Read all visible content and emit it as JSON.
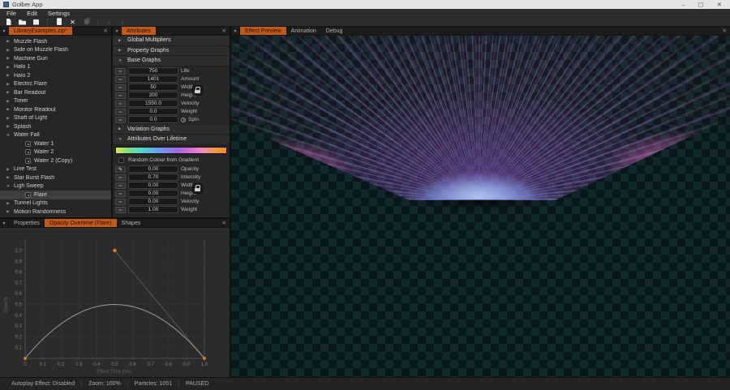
{
  "window": {
    "title": "Golber App",
    "minimize": "–",
    "maximize": "▢",
    "close": "✕"
  },
  "menu": {
    "items": [
      "File",
      "Edit",
      "Settings"
    ]
  },
  "toolbar": {
    "buttons": [
      {
        "name": "new-file-icon",
        "enabled": true
      },
      {
        "name": "open-file-icon",
        "enabled": true
      },
      {
        "name": "save-file-icon",
        "enabled": true
      },
      {
        "name": "separator"
      },
      {
        "name": "paste-icon",
        "enabled": true
      },
      {
        "name": "delete-icon",
        "enabled": true
      },
      {
        "name": "copy-icon",
        "enabled": false
      },
      {
        "name": "separator"
      },
      {
        "name": "move-up-icon",
        "enabled": false
      },
      {
        "name": "move-down-icon",
        "enabled": false
      }
    ]
  },
  "icons": {
    "close": "✕",
    "collapsed": "▶",
    "expanded": "▼",
    "dots": "•••",
    "pencil": "✎"
  },
  "library_panel": {
    "tab": "LibraryExamples.zip*",
    "items": [
      {
        "label": "Muzzle Flash",
        "arrow": "collapsed"
      },
      {
        "label": "Side on Muzzle Flash",
        "arrow": "collapsed"
      },
      {
        "label": "Machine Gun",
        "arrow": "collapsed"
      },
      {
        "label": "Halo 1",
        "arrow": "collapsed"
      },
      {
        "label": "Halo 2",
        "arrow": "collapsed"
      },
      {
        "label": "Electric Flare",
        "arrow": "collapsed"
      },
      {
        "label": "Bar Readout",
        "arrow": "collapsed"
      },
      {
        "label": "Timer",
        "arrow": "collapsed"
      },
      {
        "label": "Monitor Readout",
        "arrow": "collapsed"
      },
      {
        "label": "Shaft of Light",
        "arrow": "collapsed"
      },
      {
        "label": "Splash",
        "arrow": "collapsed"
      },
      {
        "label": "Water Fall",
        "arrow": "expanded"
      },
      {
        "label": "Water 1",
        "depth": 1,
        "icon": "effect-thumbnail-icon"
      },
      {
        "label": "Water 2",
        "depth": 1,
        "icon": "effect-thumbnail-icon"
      },
      {
        "label": "Water 2 (Copy)",
        "depth": 1,
        "icon": "effect-thumbnail-icon"
      },
      {
        "label": "Line Test",
        "arrow": "collapsed"
      },
      {
        "label": "Star Burst Flash",
        "arrow": "collapsed"
      },
      {
        "label": "Ligh Sweep",
        "arrow": "expanded"
      },
      {
        "label": "Flare",
        "depth": 1,
        "icon": "effect-thumbnail-icon",
        "selected": true
      },
      {
        "label": "Tunnel Lights",
        "arrow": "collapsed"
      },
      {
        "label": "Motion Randomness",
        "arrow": "collapsed"
      }
    ]
  },
  "attributes_panel": {
    "tab": "Attributes",
    "sections": [
      {
        "type": "header",
        "label": "Global Multipliers",
        "state": "collapsed"
      },
      {
        "type": "header",
        "label": "Property Graphs",
        "state": "collapsed"
      },
      {
        "type": "header",
        "label": "Base Graphs",
        "state": "expanded"
      },
      {
        "type": "rows",
        "rows": [
          {
            "value": "750",
            "label": "Life"
          },
          {
            "value": "1401",
            "label": "Amount"
          },
          {
            "value": "50",
            "label": "Width",
            "lock": true
          },
          {
            "value": "200",
            "label": "Height"
          },
          {
            "value": "1550.0",
            "label": "Velocity"
          },
          {
            "value": "0.0",
            "label": "Weight"
          },
          {
            "value": "0.0",
            "label": "Spin",
            "clock": true
          }
        ]
      },
      {
        "type": "header",
        "label": "Variation Graphs",
        "state": "collapsed"
      },
      {
        "type": "header",
        "label": "Attributes Over Lifetime",
        "state": "expanded"
      },
      {
        "type": "gradient"
      },
      {
        "type": "checkbox",
        "label": "Random Colour from Gradient",
        "checked": false
      },
      {
        "type": "rows",
        "rows": [
          {
            "value": "0.00",
            "label": "Opacity",
            "btn": "pencil"
          },
          {
            "value": "0.70",
            "label": "Intensity"
          },
          {
            "value": "0.00",
            "label": "Width",
            "lock": true
          },
          {
            "value": "0.00",
            "label": "Height"
          },
          {
            "value": "0.00",
            "label": "Velocity"
          },
          {
            "value": "1.00",
            "label": "Weight"
          }
        ]
      }
    ]
  },
  "preview_panel": {
    "tabs": [
      "Effect Preview",
      "Animation",
      "Debug"
    ],
    "active_tab": "Effect Preview"
  },
  "graph_panel": {
    "tabs": [
      "Properties",
      "Opacity Overtime (Flare)",
      "Shapes"
    ],
    "active_tab": "Opacity Overtime (Flare)"
  },
  "chart_data": {
    "type": "line",
    "title": "Opacity Overtime (Flare)",
    "xlabel": "Effect Time (ms)",
    "ylabel": "Opacity",
    "xlim": [
      0,
      1.0
    ],
    "ylim": [
      0,
      1.0
    ],
    "grid": true,
    "xticks": [
      "0",
      "0.1",
      "0.2",
      "0.3",
      "0.4",
      "0.5",
      "0.6",
      "0.7",
      "0.8",
      "0.9",
      "1.0"
    ],
    "yticks": [
      "0.1",
      "0.2",
      "0.3",
      "0.4",
      "0.5",
      "0.6",
      "0.7",
      "0.8",
      "0.9",
      "1.0"
    ],
    "curve": {
      "kind": "quadratic-bezier",
      "start": [
        0,
        0
      ],
      "control": [
        0.5,
        1.0
      ],
      "end": [
        1.0,
        0
      ],
      "peak_value": 0.5
    },
    "control_points": [
      [
        0,
        0
      ],
      [
        0.5,
        1.0
      ],
      [
        1.0,
        0
      ]
    ],
    "handle_line": [
      [
        0.5,
        1.0
      ],
      [
        1.0,
        0
      ]
    ],
    "point_color": "#e8821e"
  },
  "status_bar": {
    "items": [
      "Autoplay Effect: Disabled",
      "Zoom: 100%",
      "Particles: 1051",
      "PAUSED"
    ]
  },
  "colors": {
    "accent_tab": "#c2591b",
    "control_point": "#e8821e",
    "checker_dark": "#0a171a",
    "checker_light": "#13282b",
    "effect_pink": "#ff78d8",
    "effect_purple": "#9456d6",
    "effect_blue_core": "#e1eeff",
    "gradient_stops": [
      "#dde84d",
      "#7fdf83",
      "#55d9c6",
      "#59b1e8",
      "#7e8cee",
      "#a06ae0",
      "#cf6fd8",
      "#ef87c8",
      "#f59a4c",
      "#f58a28"
    ]
  }
}
